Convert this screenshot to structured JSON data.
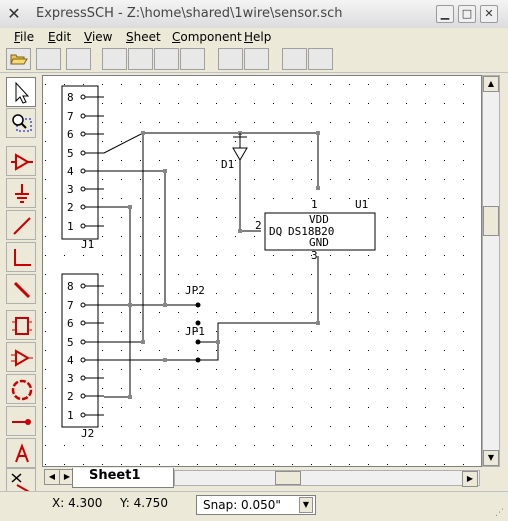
{
  "window": {
    "title": "ExpressSCH - Z:\\home\\shared\\1wire\\sensor.sch",
    "app_icon": "x-logo-icon",
    "controls": [
      "minimize",
      "maximize",
      "close"
    ]
  },
  "menu": {
    "items": [
      {
        "label": "File",
        "u": "F",
        "rest": "ile"
      },
      {
        "label": "Edit",
        "u": "E",
        "rest": "dit"
      },
      {
        "label": "View",
        "u": "V",
        "rest": "iew"
      },
      {
        "label": "Sheet",
        "u": "S",
        "rest": "heet"
      },
      {
        "label": "Component",
        "u": "C",
        "rest": "omponent"
      },
      {
        "label": "Help",
        "u": "H",
        "rest": "elp"
      }
    ]
  },
  "toolbar": {
    "open_icon": "folder-open-icon"
  },
  "tools": [
    {
      "name": "select-tool",
      "icon": "arrow-pointer-icon"
    },
    {
      "name": "zoom-tool",
      "icon": "zoom-box-icon"
    },
    {
      "name": "component-tool",
      "icon": "buffer-gate-icon"
    },
    {
      "name": "ground-tool",
      "icon": "ground-icon"
    },
    {
      "name": "wire-tool",
      "icon": "wire-icon"
    },
    {
      "name": "line-tool",
      "icon": "line-corner-icon"
    },
    {
      "name": "bus-tool",
      "icon": "bus-icon"
    },
    {
      "name": "chip-tool",
      "icon": "ic-chip-icon"
    },
    {
      "name": "gate-tool",
      "icon": "gate-icon"
    },
    {
      "name": "circle-tool",
      "icon": "circle-icon"
    },
    {
      "name": "junction-tool",
      "icon": "junction-icon"
    },
    {
      "name": "text-tool",
      "icon": "text-a-icon"
    },
    {
      "name": "delete-tool",
      "icon": "delete-icon"
    }
  ],
  "schematic": {
    "j1": {
      "label": "J1",
      "pins": [
        "8",
        "7",
        "6",
        "5",
        "4",
        "3",
        "2",
        "1"
      ]
    },
    "j2": {
      "label": "J2",
      "pins": [
        "8",
        "7",
        "6",
        "5",
        "4",
        "3",
        "2",
        "1"
      ]
    },
    "u1": {
      "ref": "U1",
      "name": "DS18B20",
      "pin_vdd": "VDD",
      "pin_dq": "DQ",
      "pin_gnd": "GND",
      "pin1": "1",
      "pin2": "2",
      "pin3": "3"
    },
    "d1": {
      "ref": "D1"
    },
    "jp1": {
      "ref": "JP1"
    },
    "jp2": {
      "ref": "JP2"
    }
  },
  "tabs": {
    "active": "Sheet1"
  },
  "status": {
    "x": "X: 4.300",
    "y": "Y: 4.750",
    "snap": "Snap:  0.050\""
  },
  "colors": {
    "tool_red": "#cc0000",
    "canvas_bg": "#ffffff"
  }
}
